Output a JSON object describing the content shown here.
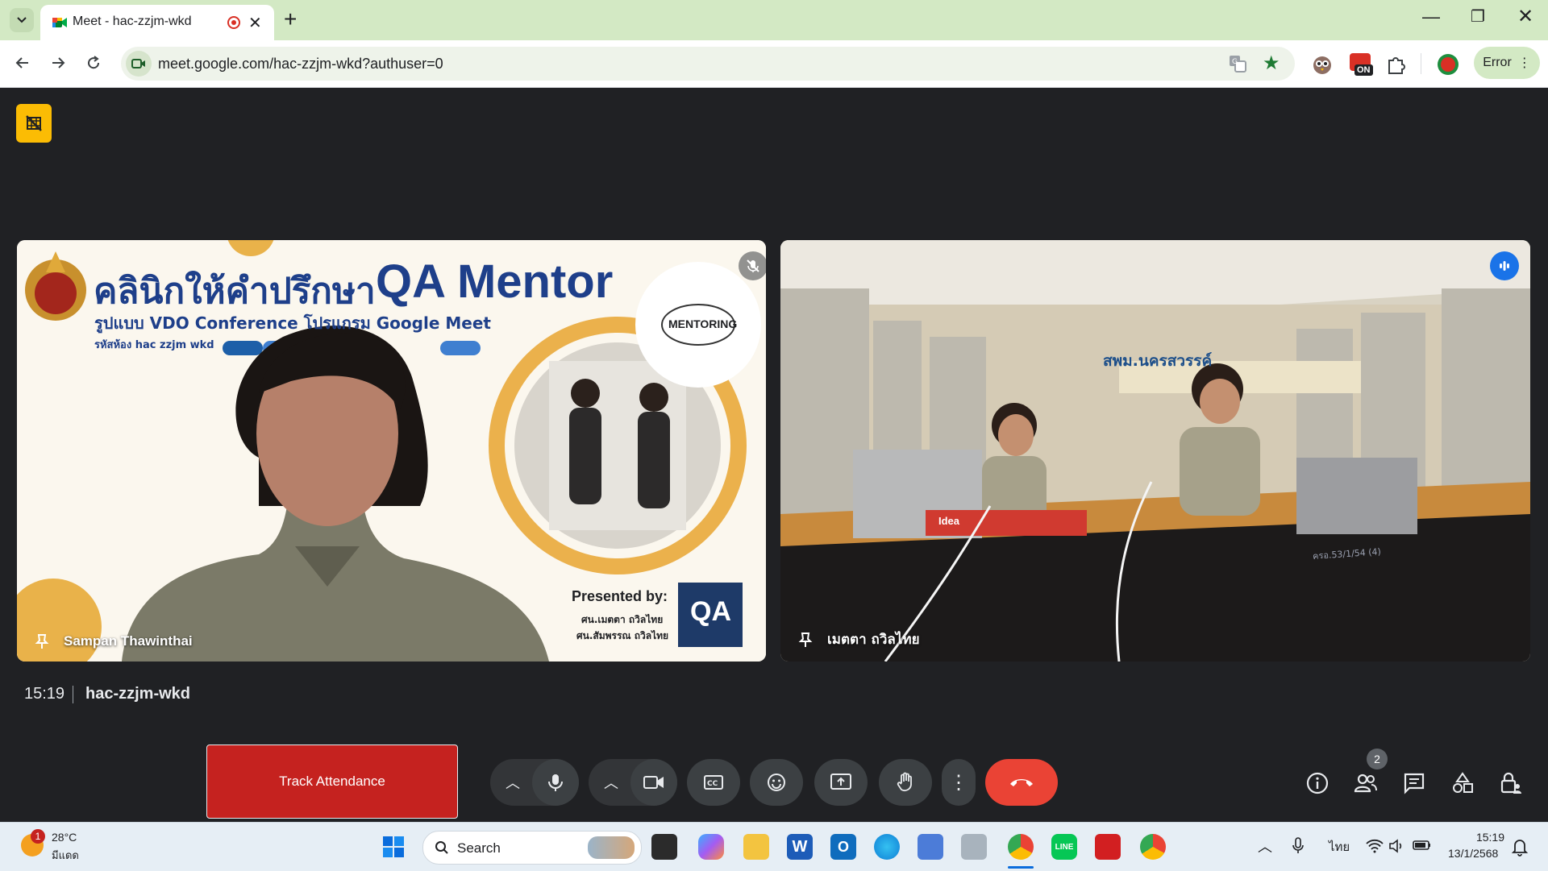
{
  "browser": {
    "tab_title": "Meet - hac-zzjm-wkd",
    "url": "meet.google.com/hac-zzjm-wkd?authuser=0",
    "error_label": "Error",
    "extension_badge": "ON"
  },
  "meet": {
    "participants": [
      {
        "name": "Sampan Thawinthai",
        "slide": {
          "title_thai": "คลินิกให้คำปรึกษา",
          "title_en": "QA Mentor",
          "subtitle": "รูปแบบ VDO Conference โปรแกรม Google Meet",
          "room_code": "รหัสห้อง hac zzjm wkd",
          "mentoring_label": "MENTORING",
          "presented_by": "Presented by:",
          "presenter_1": "ศน.เมตตา ถวิลไทย",
          "presenter_2": "ศน.สัมพรรณ ถวิลไทย",
          "qa_logo": "QA"
        }
      },
      {
        "name": "เมตตา ถวิลไทย",
        "room_sign": "สพม.นครสวรรค์",
        "table_label": "ครอ.53/1/54 (4)",
        "box_brand": "Idea"
      }
    ],
    "clock": "15:19",
    "meeting_code": "hac-zzjm-wkd",
    "track_attendance_label": "Track Attendance",
    "people_count": "2"
  },
  "taskbar": {
    "weather_temp": "28°C",
    "weather_desc": "มีแดด",
    "weather_badge": "1",
    "search_label": "Search",
    "language": "ไทย",
    "time": "15:19",
    "date": "13/1/2568"
  },
  "colors": {
    "meet_bg": "#202124",
    "end_call": "#ea4335",
    "track_btn": "#c5221f",
    "tabbar": "#d3e9c4"
  }
}
